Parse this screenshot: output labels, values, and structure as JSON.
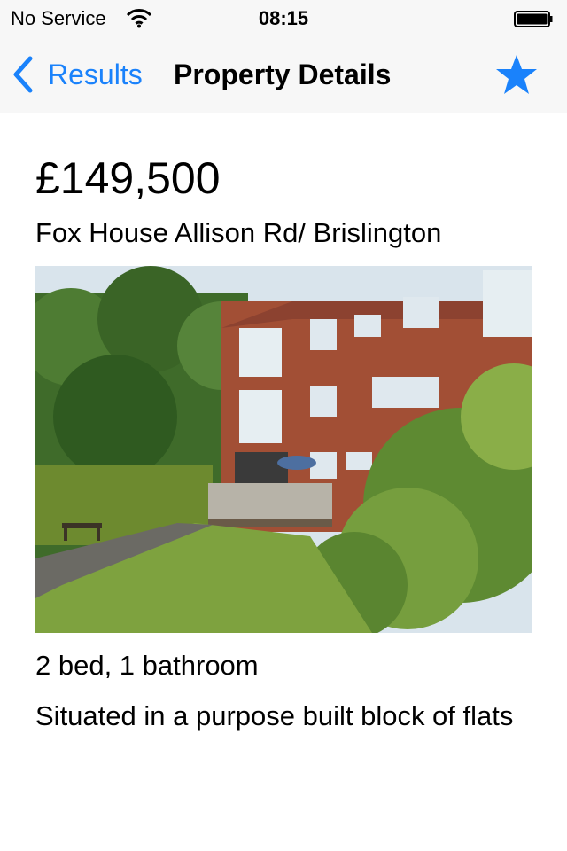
{
  "status_bar": {
    "carrier": "No Service",
    "time": "08:15",
    "wifi_icon": "wifi-icon",
    "battery_icon": "battery-icon"
  },
  "nav_bar": {
    "back_label": "Results",
    "title": "Property Details",
    "favorite_icon": "star-icon",
    "accent_color": "#1a82fb"
  },
  "listing": {
    "price": "£149,500",
    "address": "Fox House Allison Rd/ Brislington",
    "rooms": "2 bed, 1 bathroom",
    "description": "Situated in a purpose built block of flats"
  }
}
